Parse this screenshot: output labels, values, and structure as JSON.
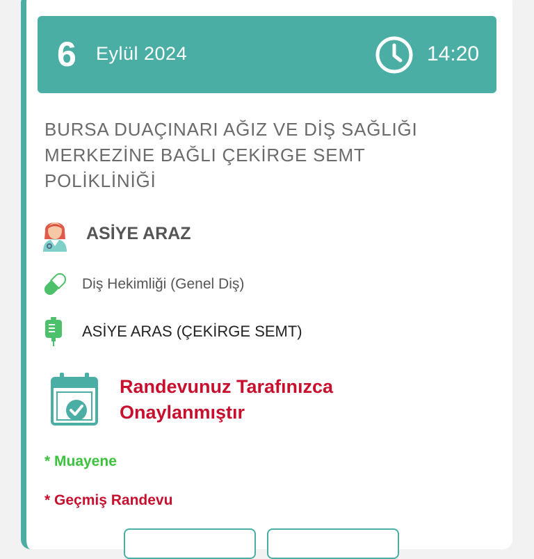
{
  "header": {
    "day": "6",
    "month_year": "Eylül  2024",
    "time": "14:20"
  },
  "clinic": {
    "name": "BURSA DUAÇINARI AĞIZ VE DİŞ SAĞLIĞI MERKEZİNE BAĞLI ÇEKİRGE SEMT POLİKLİNİĞİ"
  },
  "doctor": {
    "name": "ASİYE ARAZ",
    "icon": "doctor-avatar-icon"
  },
  "branch": {
    "name": "Diş Hekimliği (Genel Diş)",
    "icon": "pill-icon"
  },
  "location": {
    "name": "ASİYE ARAS (ÇEKİRGE SEMT)",
    "icon": "iv-bag-icon"
  },
  "status": {
    "line1": "Randevunuz Tarafınızca",
    "line2": "Onaylanmıştır",
    "icon": "calendar-check-icon"
  },
  "legend": {
    "examination": "* Muayene",
    "past_appointment": "* Geçmiş Randevu"
  },
  "colors": {
    "accent": "#4aaea5",
    "status_red": "#c8102e",
    "legend_green": "#3cc23c"
  }
}
